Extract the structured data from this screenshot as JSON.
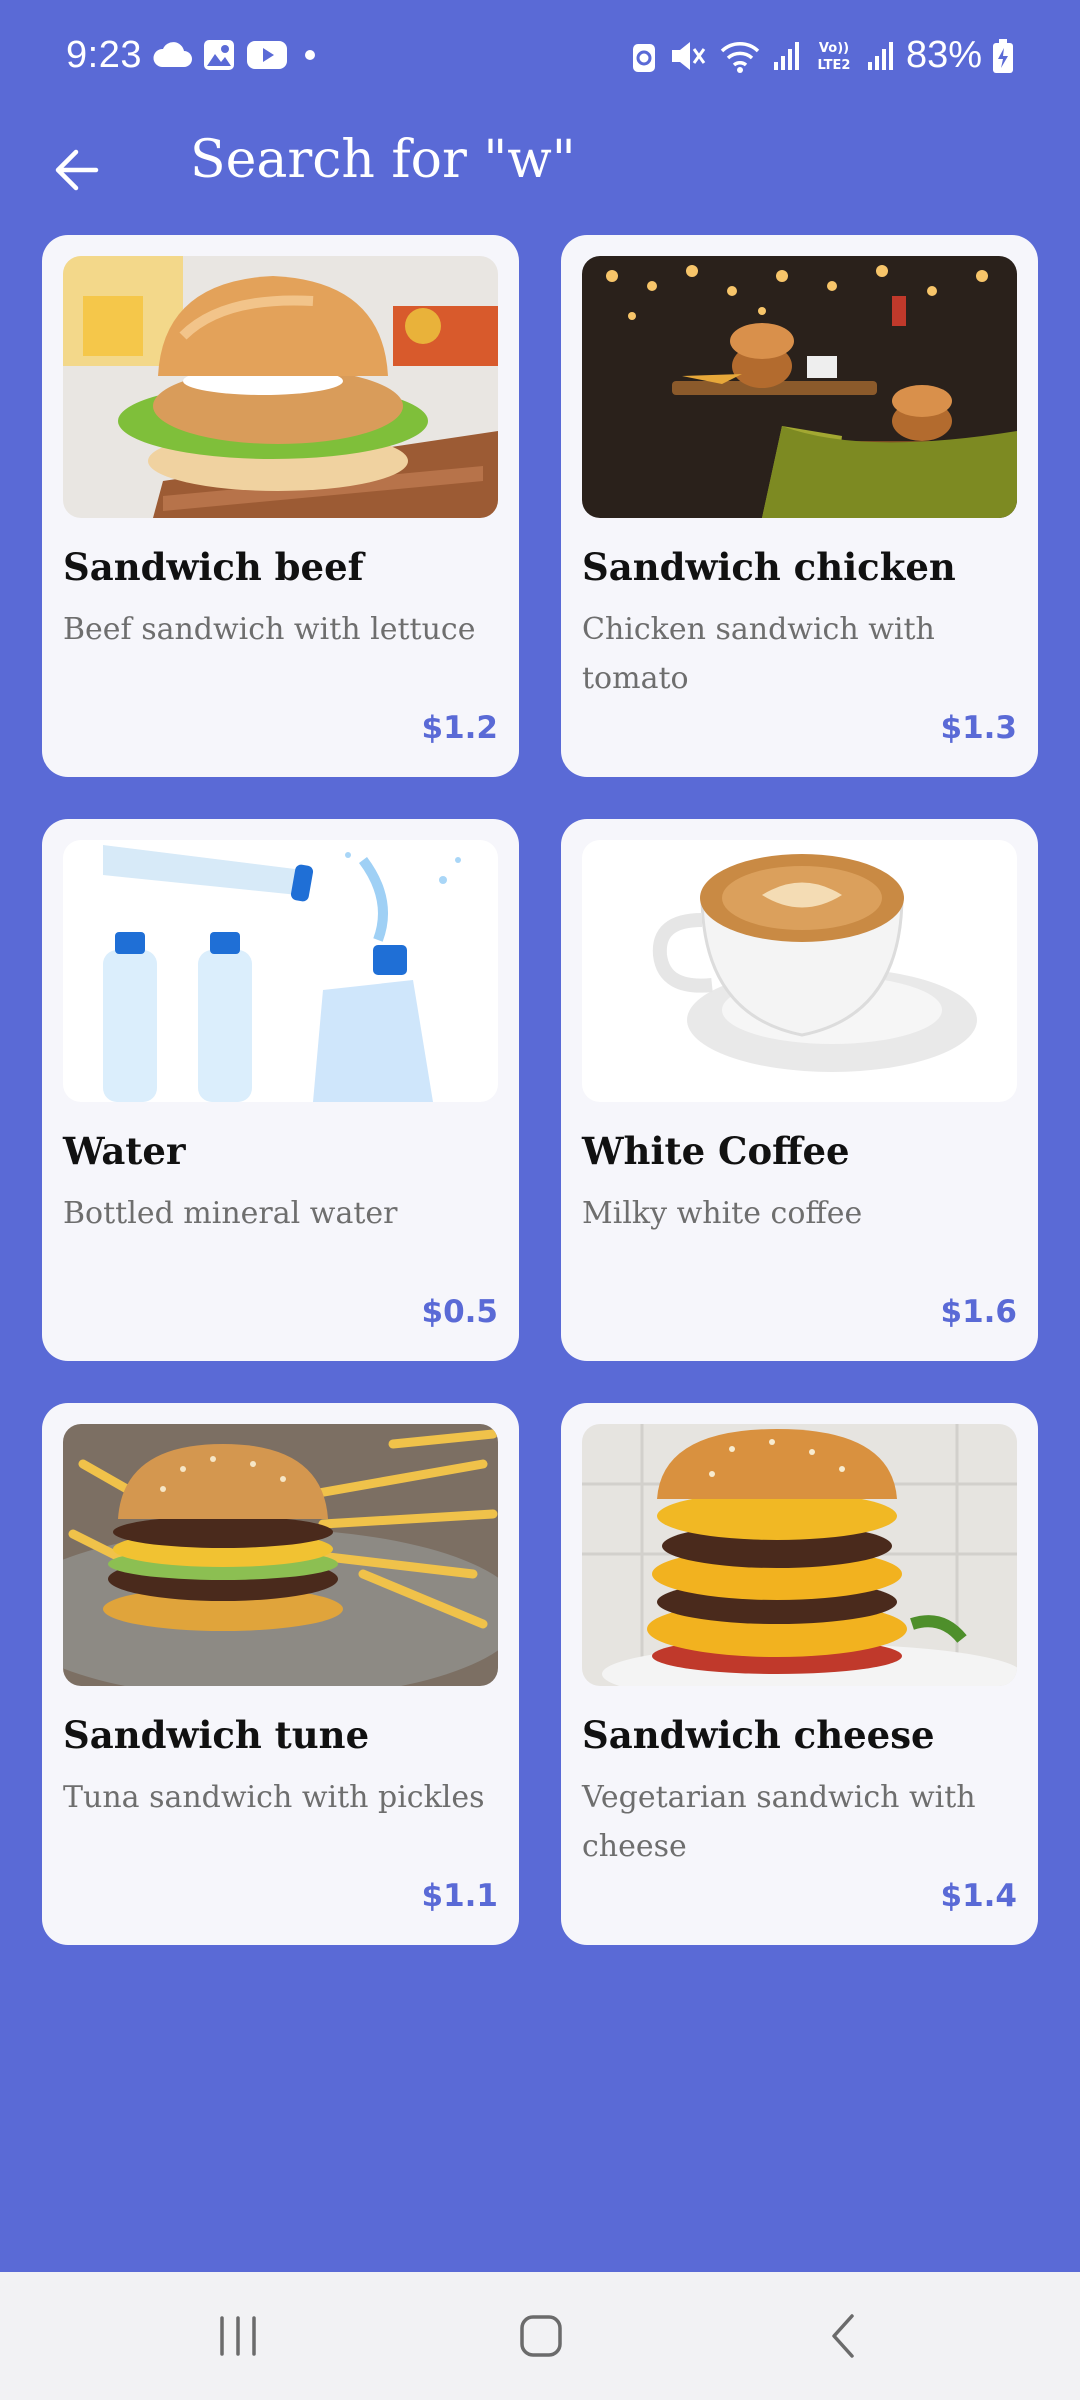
{
  "status_bar": {
    "time": "9:23",
    "battery_percent": "83%",
    "left_icons": [
      "cloud-icon",
      "gallery-icon",
      "youtube-icon",
      "dot-icon"
    ],
    "right_icons": [
      "alarm-icon",
      "mute-icon",
      "wifi-icon",
      "signal-icon",
      "volte-icon",
      "signal-icon",
      "battery-icon"
    ],
    "volte_text": "Vo) LTE2"
  },
  "header": {
    "title": "Search for \"w\"",
    "back_icon": "arrow-left-icon"
  },
  "colors": {
    "background": "#5a6ad6",
    "card": "#f6f6fb",
    "price": "#5a6ad6",
    "nav_bar": "#f2f2f4"
  },
  "products": [
    {
      "title": "Sandwich beef",
      "description": "Beef sandwich with lettuce",
      "price": "$1.2",
      "image": "chicken-sandwich-photo"
    },
    {
      "title": "Sandwich chicken",
      "description": "Chicken sandwich with tomato",
      "price": "$1.3",
      "image": "burger-tray-photo"
    },
    {
      "title": "Water",
      "description": "Bottled mineral water",
      "price": "$0.5",
      "image": "water-bottles-photo"
    },
    {
      "title": "White Coffee",
      "description": "Milky white coffee",
      "price": "$1.6",
      "image": "coffee-cup-photo"
    },
    {
      "title": "Sandwich tune",
      "description": "Tuna sandwich with pickles",
      "price": "$1.1",
      "image": "burger-fries-photo"
    },
    {
      "title": "Sandwich cheese",
      "description": "Vegetarian sandwich with cheese",
      "price": "$1.4",
      "image": "cheese-burger-photo"
    }
  ],
  "nav_bar": {
    "items": [
      "recent-apps-icon",
      "home-icon",
      "back-icon"
    ]
  }
}
